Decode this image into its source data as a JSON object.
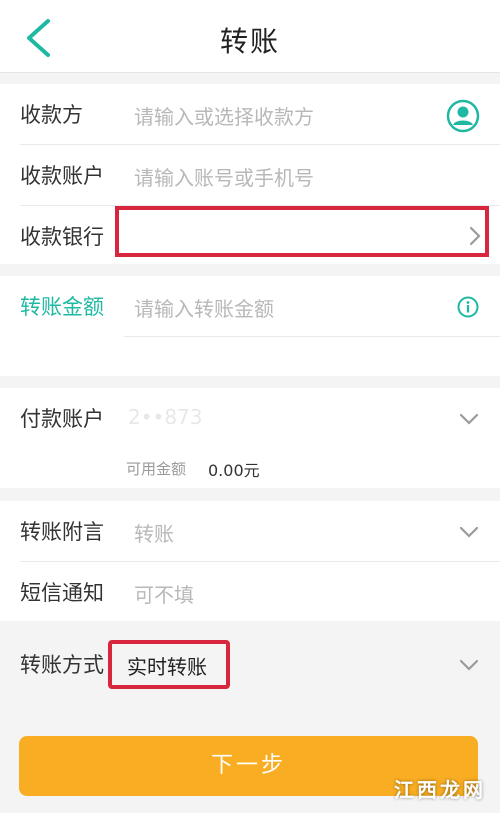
{
  "header": {
    "title": "转账"
  },
  "payee": {
    "name_label": "收款方",
    "name_placeholder": "请输入或选择收款方",
    "account_label": "收款账户",
    "account_placeholder": "请输入账号或手机号",
    "bank_label": "收款银行"
  },
  "amount": {
    "label": "转账金额",
    "placeholder": "请输入转账金额"
  },
  "payer": {
    "account_label": "付款账户",
    "account_value": "2••873",
    "balance_label": "可用金额",
    "balance_value": "0.00元"
  },
  "extra": {
    "remark_label": "转账附言",
    "remark_value": "转账",
    "sms_label": "短信通知",
    "sms_placeholder": "可不填"
  },
  "method": {
    "label": "转账方式",
    "value": "实时转账"
  },
  "actions": {
    "next_label": "下一步"
  },
  "watermark": "江西龙网",
  "colors": {
    "accent": "#1fb9a3",
    "button": "#f8ad22",
    "highlight": "#d7263d"
  }
}
